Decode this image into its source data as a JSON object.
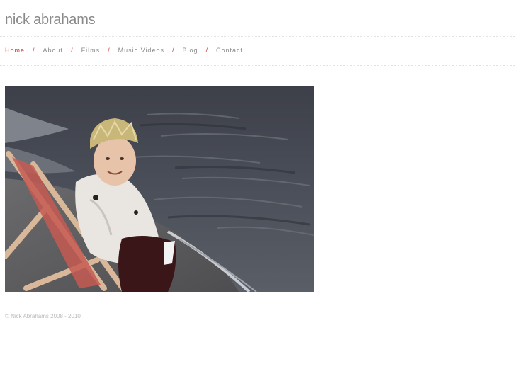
{
  "header": {
    "site_title": "nick abrahams"
  },
  "nav": {
    "items": [
      {
        "label": "Home",
        "active": true
      },
      {
        "label": "About",
        "active": false
      },
      {
        "label": "Films",
        "active": false
      },
      {
        "label": "Music Videos",
        "active": false
      },
      {
        "label": "Blog",
        "active": false
      },
      {
        "label": "Contact",
        "active": false
      }
    ],
    "separator": "/"
  },
  "hero": {
    "image_subject": "child-in-crown-on-beach-deckchair-photo"
  },
  "footer": {
    "copyright": "© Nick Abrahams 2008 - 2010"
  },
  "colors": {
    "accent": "#d2362d",
    "text_muted": "#8a8a8a",
    "footer_text": "#b9b9b9"
  }
}
